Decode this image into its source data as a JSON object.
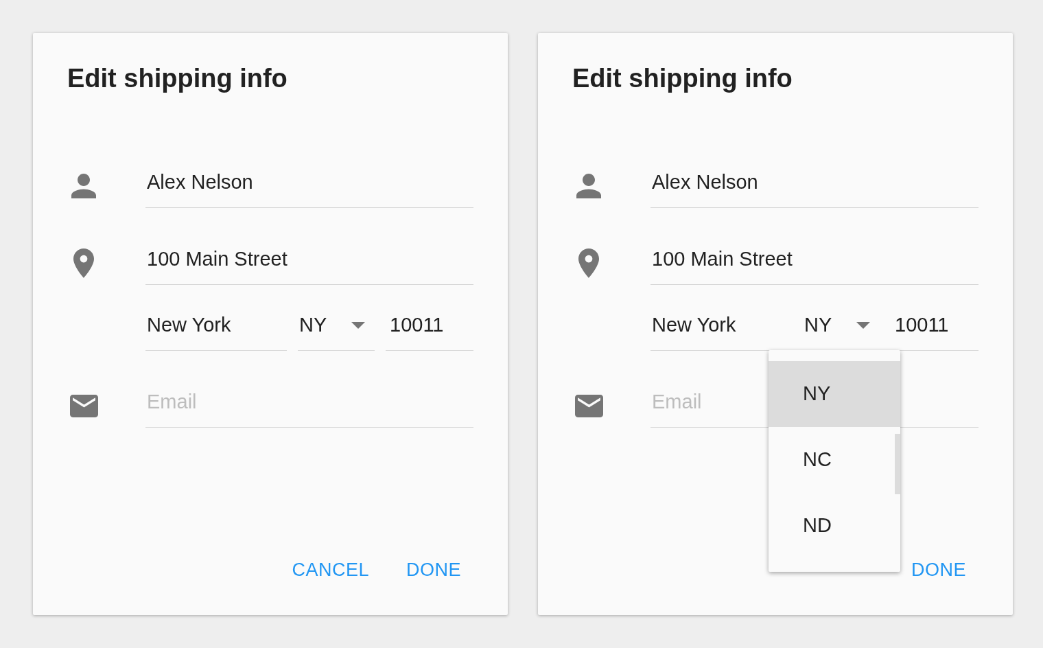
{
  "dialogs": [
    {
      "title": "Edit shipping info",
      "fields": [
        {
          "kind": "name",
          "value": "Alex Nelson"
        },
        {
          "kind": "street",
          "value": "100 Main Street"
        },
        {
          "kind": "address",
          "city": "New York",
          "state": "NY",
          "zip": "10011"
        },
        {
          "kind": "email",
          "placeholder": "Email"
        }
      ],
      "actions": [
        {
          "label": "CANCEL"
        },
        {
          "label": "DONE"
        }
      ]
    },
    {
      "title": "Edit shipping info",
      "fields": [
        {
          "kind": "name",
          "value": "Alex Nelson"
        },
        {
          "kind": "street",
          "value": "100 Main Street"
        },
        {
          "kind": "address",
          "city": "New York",
          "state": "NY",
          "zip": "10011"
        },
        {
          "kind": "email",
          "placeholder": "Email"
        }
      ],
      "actions": [
        {
          "label": "DONE"
        }
      ],
      "state_menu": {
        "options": [
          {
            "label": "NY",
            "selected": true
          },
          {
            "label": "NC",
            "selected": false
          },
          {
            "label": "ND",
            "selected": false
          }
        ]
      }
    }
  ]
}
